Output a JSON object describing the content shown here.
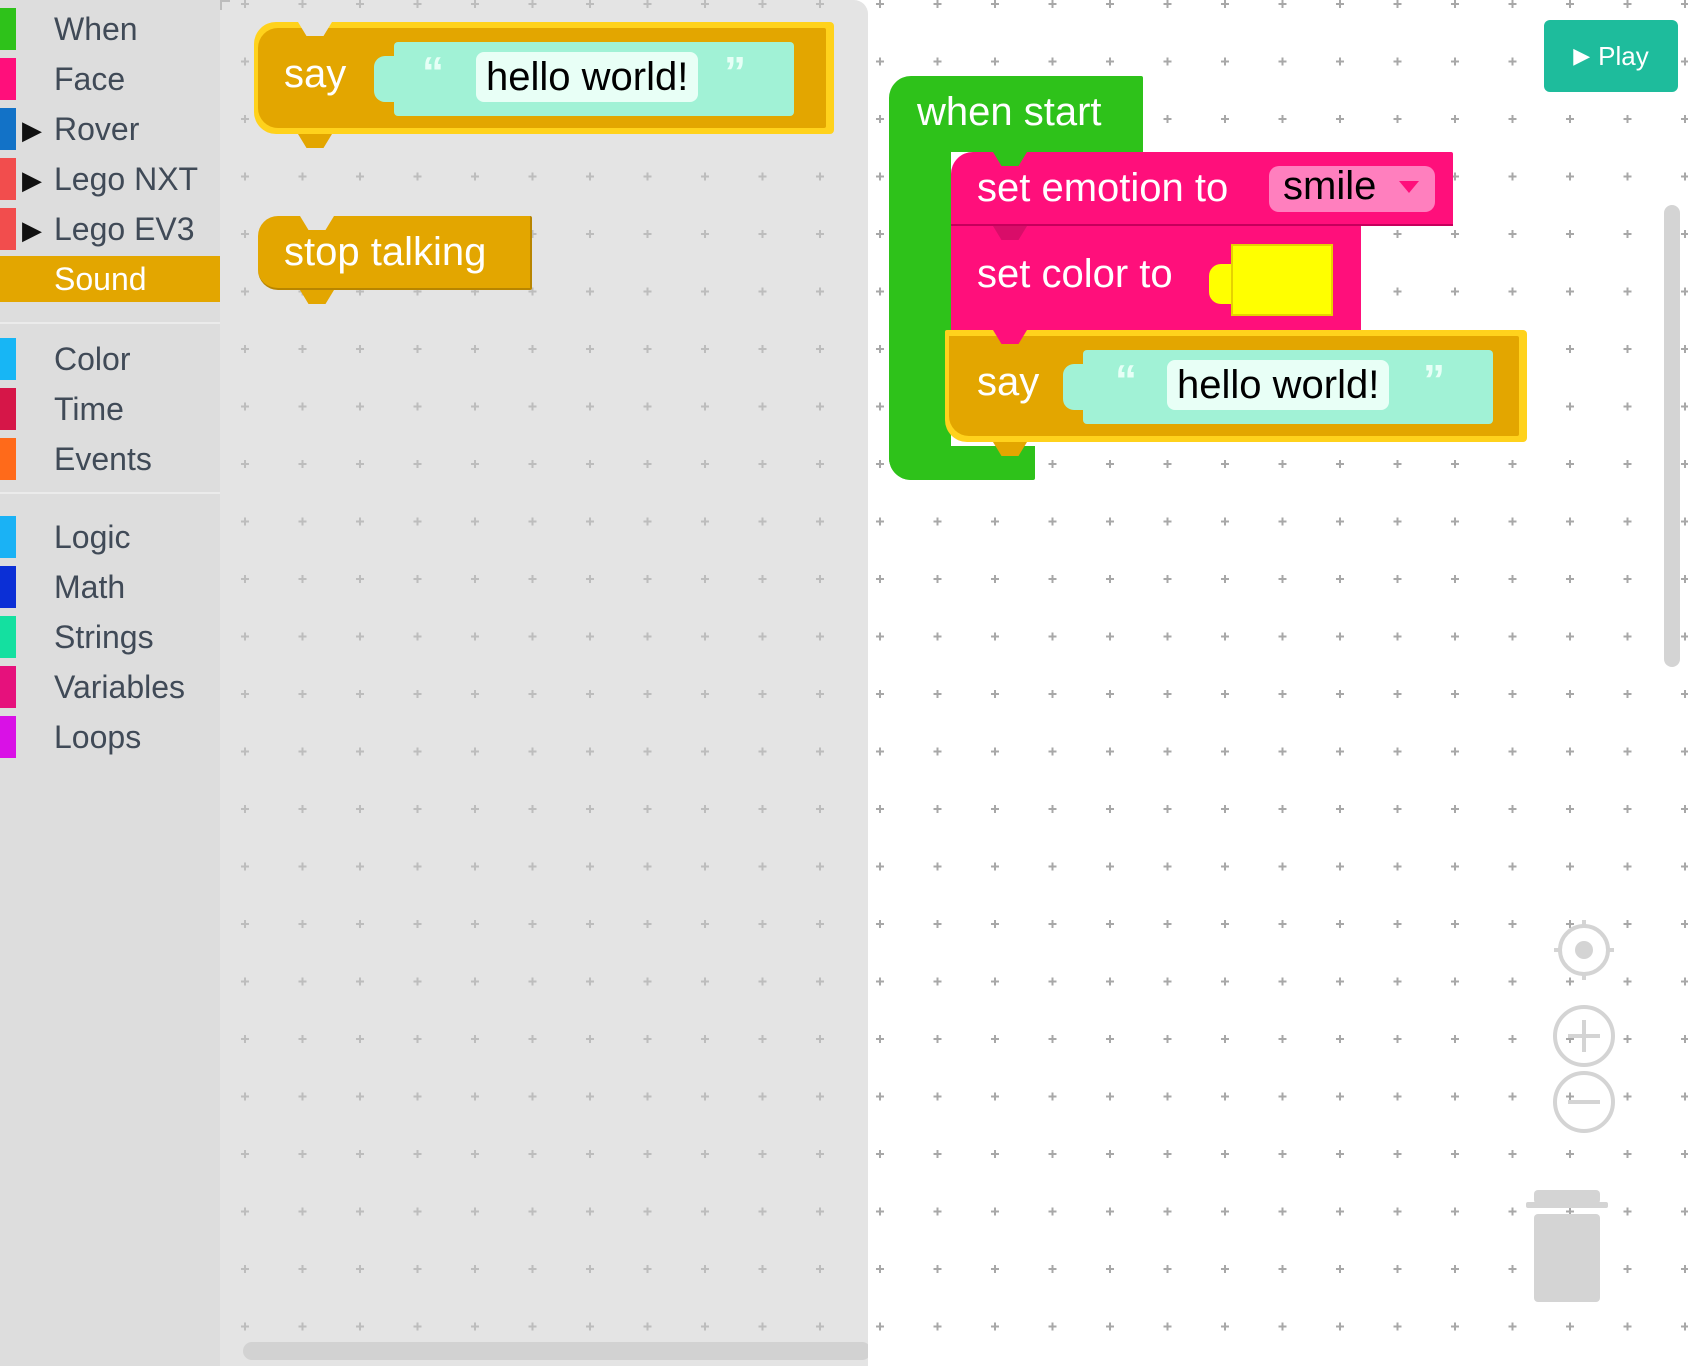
{
  "toolbox": {
    "categories": [
      {
        "label": "When",
        "color": "#2ec21a",
        "arrow": ""
      },
      {
        "label": "Face",
        "color": "#ff0f7b",
        "arrow": ""
      },
      {
        "label": "Rover",
        "color": "#1272c7",
        "arrow": "▶"
      },
      {
        "label": "Lego NXT",
        "color": "#f24d4d",
        "arrow": "▶"
      },
      {
        "label": "Lego EV3",
        "color": "#f24d4d",
        "arrow": "▶"
      },
      {
        "label": "Sound",
        "color": "#e3a600",
        "arrow": ""
      },
      {
        "label": "Color",
        "color": "#17b6f5",
        "arrow": ""
      },
      {
        "label": "Time",
        "color": "#d61648",
        "arrow": ""
      },
      {
        "label": "Events",
        "color": "#ff6a1a",
        "arrow": ""
      },
      {
        "label": "Logic",
        "color": "#1ab2f5",
        "arrow": ""
      },
      {
        "label": "Math",
        "color": "#0b2fd6",
        "arrow": ""
      },
      {
        "label": "Strings",
        "color": "#14e0a0",
        "arrow": ""
      },
      {
        "label": "Variables",
        "color": "#e6117c",
        "arrow": ""
      },
      {
        "label": "Loops",
        "color": "#d911e6",
        "arrow": ""
      }
    ],
    "selected": "Sound"
  },
  "flyout": {
    "say_block": {
      "label": "say",
      "text": "hello world!",
      "open_quote": "“",
      "close_quote": "”"
    },
    "stop_block": {
      "label": "stop talking"
    }
  },
  "workspace": {
    "hat": {
      "label": "when start"
    },
    "emotion_block": {
      "label": "set emotion to",
      "value": "smile",
      "dropdown_icon": "triangle-down-icon"
    },
    "color_block": {
      "label": "set color to",
      "value": "#ffff00"
    },
    "say_block": {
      "label": "say",
      "text": "hello world!",
      "open_quote": "“",
      "close_quote": "”"
    }
  },
  "play_button": {
    "label": "Play",
    "icon": "play-icon"
  },
  "controls": {
    "recenter": "target-icon",
    "zoom_in": "plus-icon",
    "zoom_out": "minus-icon",
    "trash": "trash-icon"
  },
  "colors": {
    "event": "#2ec21a",
    "face": "#ff0f7b",
    "sound": "#e3a600",
    "sound_border": "#ffd21c",
    "string": "#a1f2d6",
    "accent": "#1ebc9c"
  }
}
